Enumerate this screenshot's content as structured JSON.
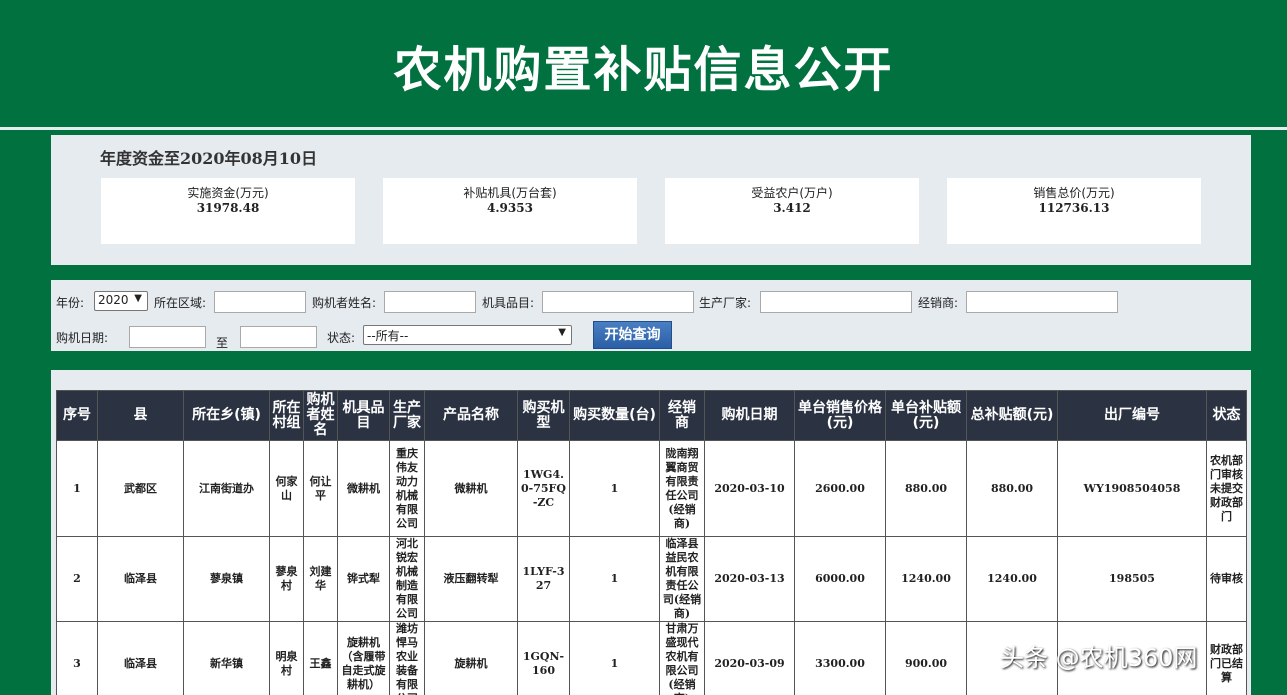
{
  "header": {
    "title": "农机购置补贴信息公开"
  },
  "summary": {
    "fund_title": "年度资金至2020年08月10日",
    "cards": [
      {
        "label": "实施资金(万元)",
        "value": "31978.48"
      },
      {
        "label": "补贴机具(万台套)",
        "value": "4.9353"
      },
      {
        "label": "受益农户(万户)",
        "value": "3.412"
      },
      {
        "label": "销售总价(万元)",
        "value": "112736.13"
      }
    ]
  },
  "filters": {
    "year_label": "年份:",
    "year_value": "2020",
    "region_label": "所在区域:",
    "buyer_label": "购机者姓名:",
    "category_label": "机具品目:",
    "manufacturer_label": "生产厂家:",
    "dealer_label": "经销商:",
    "date_label": "购机日期:",
    "date_to": "至",
    "status_label": "状态:",
    "status_value": "--所有--",
    "query_button": "开始查询"
  },
  "table": {
    "columns": [
      "序号",
      "县",
      "所在乡(镇)",
      "所在村组",
      "购机者姓名",
      "机具品目",
      "生产厂家",
      "产品名称",
      "购买机型",
      "购买数量(台)",
      "经销商",
      "购机日期",
      "单台销售价格(元)",
      "单台补贴额(元)",
      "总补贴额(元)",
      "出厂编号",
      "状态"
    ],
    "rows": [
      [
        "1",
        "武都区",
        "江南街道办",
        "何家山",
        "何让平",
        "微耕机",
        "重庆伟友动力机械有限公司",
        "微耕机",
        "1WG4.0-75FQ-ZC",
        "1",
        "陇南翔翼商贸有限责任公司(经销商)",
        "2020-03-10",
        "2600.00",
        "880.00",
        "880.00",
        "WY1908504058",
        "农机部门审核未提交财政部门"
      ],
      [
        "2",
        "临泽县",
        "蓼泉镇",
        "蓼泉村",
        "刘建华",
        "铧式犁",
        "河北锐宏机械制造有限公司",
        "液压翻转犁",
        "1LYF-327",
        "1",
        "临泽县益民农机有限责任公司(经销商)",
        "2020-03-13",
        "6000.00",
        "1240.00",
        "1240.00",
        "198505",
        "待审核"
      ],
      [
        "3",
        "临泽县",
        "新华镇",
        "明泉村",
        "王鑫",
        "旋耕机（含履带自走式旋耕机）",
        "潍坊悍马农业装备有限公司",
        "旋耕机",
        "1GQN-160",
        "1",
        "甘肃万盛现代农机有限公司(经销商)",
        "2020-03-09",
        "3300.00",
        "900.00",
        "",
        "",
        "财政部门已结算"
      ]
    ]
  },
  "watermark": "头条 @农机360网"
}
